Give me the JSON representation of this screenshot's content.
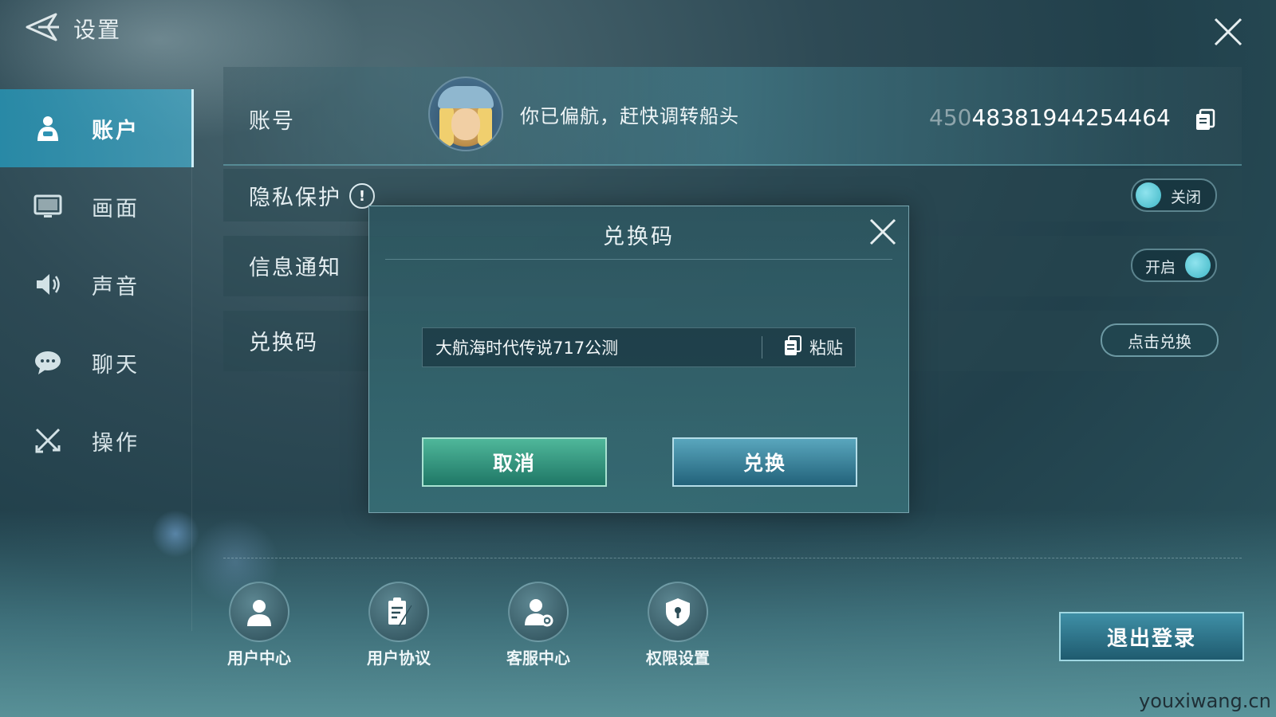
{
  "header": {
    "title": "设置",
    "back_icon": "back-arrow-icon",
    "close_icon": "close-icon"
  },
  "sidebar": {
    "items": [
      {
        "label": "账户",
        "icon": "account-icon",
        "active": true
      },
      {
        "label": "画面",
        "icon": "monitor-icon",
        "active": false
      },
      {
        "label": "声音",
        "icon": "speaker-icon",
        "active": false
      },
      {
        "label": "聊天",
        "icon": "chat-bubble-icon",
        "active": false
      },
      {
        "label": "操作",
        "icon": "crossed-swords-icon",
        "active": false
      }
    ]
  },
  "account": {
    "label": "账号",
    "nickname": "你已偏航，赶快调转船头",
    "uid_prefix": "450",
    "uid_rest": "48381944254464"
  },
  "privacy": {
    "label": "隐私保护",
    "info_glyph": "!",
    "toggle_text": "关闭",
    "state": "off"
  },
  "notify": {
    "label": "信息通知",
    "toggle_text": "开启",
    "state": "on"
  },
  "redeem_row": {
    "label": "兑换码",
    "button": "点击兑换"
  },
  "bottom_links": [
    {
      "label": "用户中心",
      "icon": "user-icon"
    },
    {
      "label": "用户协议",
      "icon": "document-quill-icon"
    },
    {
      "label": "客服中心",
      "icon": "support-gear-icon"
    },
    {
      "label": "权限设置",
      "icon": "shield-lock-icon"
    }
  ],
  "logout_button": "退出登录",
  "watermark": "youxiwang.cn",
  "dialog": {
    "title": "兑换码",
    "input_value": "大航海时代传说717公测",
    "paste_label": "粘贴",
    "cancel_label": "取消",
    "confirm_label": "兑换"
  },
  "colors": {
    "accent": "#3fb7c6",
    "active_tab": "#2f93b3",
    "cancel_green": "#2f9a80",
    "confirm_blue": "#2f7f99"
  }
}
